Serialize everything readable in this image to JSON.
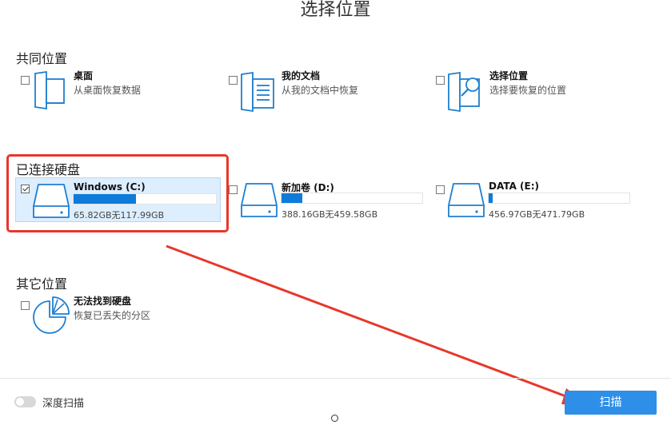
{
  "header": {
    "title": "选择位置"
  },
  "common": {
    "heading": "共同位置",
    "items": [
      {
        "title": "桌面",
        "subtitle": "从桌面恢复数据",
        "icon": "desktop-folder-icon"
      },
      {
        "title": "我的文档",
        "subtitle": "从我的文档中恢复",
        "icon": "documents-icon"
      },
      {
        "title": "选择位置",
        "subtitle": "选择要恢复的位置",
        "icon": "folder-search-icon"
      }
    ]
  },
  "disks": {
    "heading": "已连接硬盘",
    "items": [
      {
        "name": "Windows (C:)",
        "size": "65.82GB无117.99GB",
        "fill": 0.44,
        "checked": true,
        "selected": true
      },
      {
        "name": "新加卷 (D:)",
        "size": "388.16GB无459.58GB",
        "fill": 0.15,
        "checked": false,
        "selected": false
      },
      {
        "name": "DATA (E:)",
        "size": "456.97GB无471.79GB",
        "fill": 0.03,
        "checked": false,
        "selected": false
      }
    ]
  },
  "other": {
    "heading": "其它位置",
    "items": [
      {
        "title": "无法找到硬盘",
        "subtitle": "恢复已丢失的分区",
        "icon": "partition-pie-icon"
      }
    ]
  },
  "footer": {
    "deep_scan_label": "深度扫描",
    "deep_scan_on": false,
    "scan_button_label": "扫描"
  },
  "colors": {
    "accent": "#0d7bd9",
    "icon_blue": "#1e7fd0",
    "annotation_red": "#e8372a",
    "button": "#2e8fe8"
  }
}
